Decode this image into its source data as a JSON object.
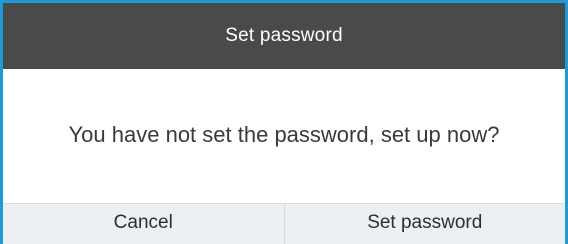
{
  "dialog": {
    "title": "Set password",
    "message": "You have not set the password, set up now?",
    "cancel_label": "Cancel",
    "confirm_label": "Set password"
  },
  "colors": {
    "title_bar_bg": "#4a4a4a",
    "frame_accent": "#1e9ad6",
    "button_bar_bg": "#eceff3"
  }
}
